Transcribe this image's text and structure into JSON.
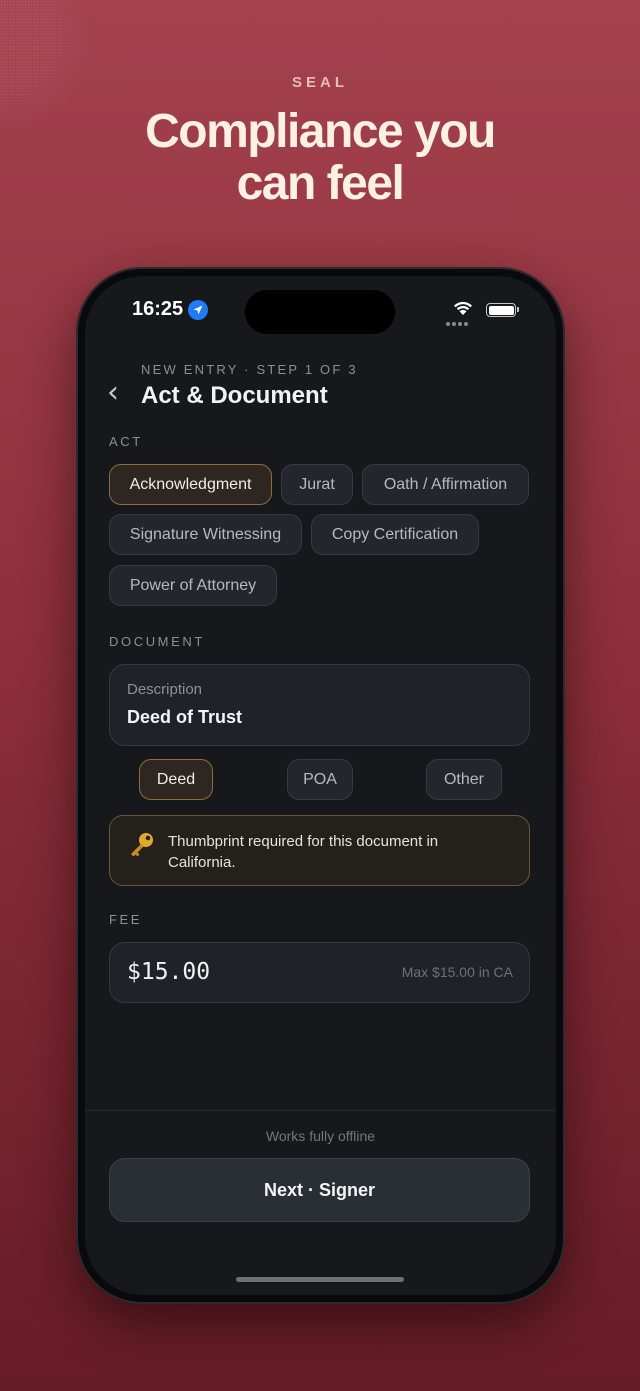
{
  "marketing": {
    "brand": "SEAL",
    "headline_line1": "Compliance you",
    "headline_line2": "can feel"
  },
  "status_bar": {
    "time": "16:25",
    "icons": [
      "location-arrow-icon",
      "cellular-dots-icon",
      "wifi-icon",
      "battery-icon"
    ]
  },
  "header": {
    "eyebrow": "NEW ENTRY · STEP 1 OF 3",
    "title": "Act & Document",
    "back_icon": "chevron-left-icon",
    "back_glyph": "‹"
  },
  "act": {
    "label": "ACT",
    "options": [
      {
        "label": "Acknowledgment",
        "selected": true
      },
      {
        "label": "Jurat",
        "selected": false
      },
      {
        "label": "Oath / Affirmation",
        "selected": false
      },
      {
        "label": "Signature Witnessing",
        "selected": false
      },
      {
        "label": "Copy Certification",
        "selected": false
      },
      {
        "label": "Power of Attorney",
        "selected": false
      }
    ]
  },
  "document": {
    "label": "DOCUMENT",
    "description_label": "Description",
    "description_value": "Deed of Trust",
    "types": [
      {
        "label": "Deed",
        "selected": true
      },
      {
        "label": "POA",
        "selected": false
      },
      {
        "label": "Other",
        "selected": false
      }
    ],
    "notice_icon": "key-icon",
    "notice": "Thumbprint required for this document in California."
  },
  "fee": {
    "label": "FEE",
    "value": "$15.00",
    "max_note": "Max $15.00 in CA"
  },
  "footer": {
    "offline_note": "Works fully offline",
    "next_label": "Next · Signer"
  },
  "colors": {
    "background_top": "#a3424d",
    "background_bottom": "#661c25",
    "screen": "#16181c",
    "accent_selected_border": "#8d6c45",
    "notice_border": "#6b5637",
    "location_blue": "#1e7cf7"
  }
}
